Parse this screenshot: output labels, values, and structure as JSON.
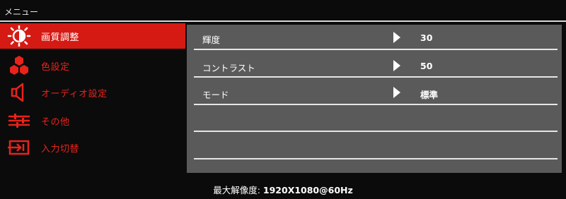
{
  "header": {
    "title": "メニュー"
  },
  "sidebar": {
    "items": [
      {
        "label": "画質調整",
        "icon": "brightness-sun-icon",
        "active": true
      },
      {
        "label": "色設定",
        "icon": "color-hexagons-icon",
        "active": false
      },
      {
        "label": "オーディオ設定",
        "icon": "speaker-icon",
        "active": false
      },
      {
        "label": "その他",
        "icon": "sliders-icon",
        "active": false
      },
      {
        "label": "入力切替",
        "icon": "input-source-icon",
        "active": false
      }
    ]
  },
  "panel": {
    "rows": [
      {
        "label": "輝度",
        "value": "30"
      },
      {
        "label": "コントラスト",
        "value": "50"
      },
      {
        "label": "モード",
        "value": "標準"
      },
      {
        "label": "",
        "value": ""
      },
      {
        "label": "",
        "value": ""
      }
    ]
  },
  "footer": {
    "label": "最大解像度: ",
    "value": "1920X1080@60Hz"
  },
  "colors": {
    "accent_red": "#d51a13",
    "panel_gray": "#5a5a5a",
    "background": "#0b0b0b"
  }
}
